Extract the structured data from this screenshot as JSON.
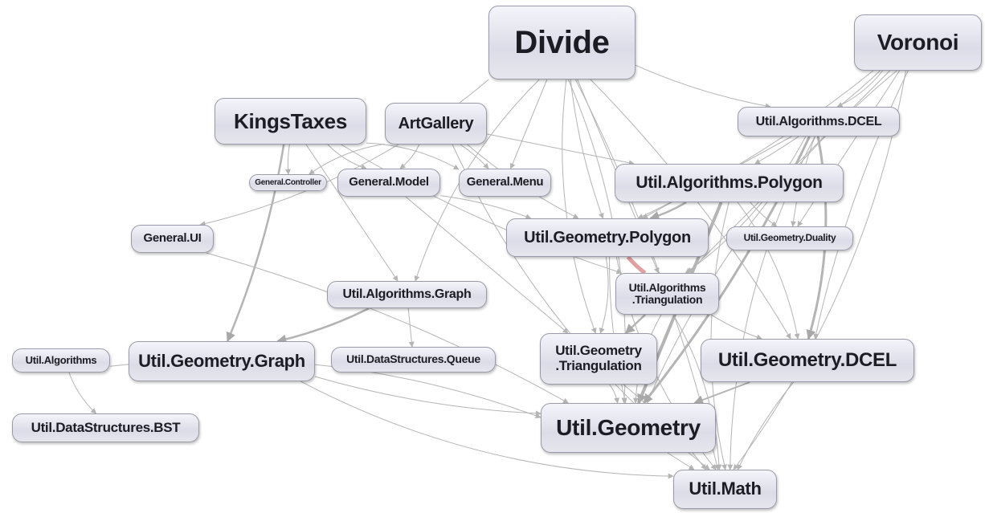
{
  "nodes": [
    {
      "id": "divide",
      "label": "Divide"
    },
    {
      "id": "voronoi",
      "label": "Voronoi"
    },
    {
      "id": "kingstaxes",
      "label": "KingsTaxes"
    },
    {
      "id": "artgallery",
      "label": "ArtGallery"
    },
    {
      "id": "alg_dcel",
      "label": "Util.Algorithms.DCEL"
    },
    {
      "id": "gen_controller",
      "label": "General.Controller"
    },
    {
      "id": "gen_model",
      "label": "General.Model"
    },
    {
      "id": "gen_menu",
      "label": "General.Menu"
    },
    {
      "id": "alg_polygon",
      "label": "Util.Algorithms.Polygon"
    },
    {
      "id": "gen_ui",
      "label": "General.UI"
    },
    {
      "id": "geo_polygon",
      "label": "Util.Geometry.Polygon"
    },
    {
      "id": "geo_duality",
      "label": "Util.Geometry.Duality"
    },
    {
      "id": "alg_triang",
      "label": "Util.Algorithms\n.Triangulation"
    },
    {
      "id": "alg_graph",
      "label": "Util.Algorithms.Graph"
    },
    {
      "id": "geo_graph",
      "label": "Util.Geometry.Graph"
    },
    {
      "id": "ds_queue",
      "label": "Util.DataStructures.Queue"
    },
    {
      "id": "geo_triang",
      "label": "Util.Geometry\n.Triangulation"
    },
    {
      "id": "geo_dcel",
      "label": "Util.Geometry.DCEL"
    },
    {
      "id": "alg",
      "label": "Util.Algorithms"
    },
    {
      "id": "ds_bst",
      "label": "Util.DataStructures.BST"
    },
    {
      "id": "geometry",
      "label": "Util.Geometry"
    },
    {
      "id": "math",
      "label": "Util.Math"
    }
  ],
  "edges": [
    [
      "divide",
      "gen_ui"
    ],
    [
      "divide",
      "math"
    ],
    [
      "divide",
      "gen_menu"
    ],
    [
      "divide",
      "geo_polygon"
    ],
    [
      "divide",
      "geo_triang"
    ],
    [
      "divide",
      "geometry"
    ],
    [
      "divide",
      "geo_dcel"
    ],
    [
      "divide",
      "alg_triang"
    ],
    [
      "divide",
      "alg_dcel"
    ],
    [
      "divide",
      "alg_graph"
    ],
    [
      "voronoi",
      "alg_dcel"
    ],
    [
      "voronoi",
      "alg_polygon"
    ],
    [
      "voronoi",
      "geo_duality"
    ],
    [
      "voronoi",
      "geo_dcel"
    ],
    [
      "voronoi",
      "geometry"
    ],
    [
      "voronoi",
      "math"
    ],
    [
      "voronoi",
      "geo_polygon"
    ],
    [
      "voronoi",
      "alg_triang"
    ],
    [
      "kingstaxes",
      "gen_controller"
    ],
    [
      "kingstaxes",
      "gen_model"
    ],
    [
      "kingstaxes",
      "gen_menu"
    ],
    [
      "kingstaxes",
      "geo_graph",
      2.5
    ],
    [
      "kingstaxes",
      "alg_graph"
    ],
    [
      "kingstaxes",
      "alg_triang"
    ],
    [
      "artgallery",
      "gen_controller"
    ],
    [
      "artgallery",
      "gen_model"
    ],
    [
      "artgallery",
      "gen_menu"
    ],
    [
      "artgallery",
      "alg_polygon"
    ],
    [
      "artgallery",
      "geo_polygon"
    ],
    [
      "artgallery",
      "math"
    ],
    [
      "alg_dcel",
      "geo_dcel",
      3
    ],
    [
      "alg_dcel",
      "geometry",
      3
    ],
    [
      "alg_dcel",
      "geo_polygon"
    ],
    [
      "alg_dcel",
      "geo_duality"
    ],
    [
      "alg_dcel",
      "math"
    ],
    [
      "alg_dcel",
      "alg_triang"
    ],
    [
      "alg_polygon",
      "geo_polygon",
      2.5
    ],
    [
      "alg_polygon",
      "geometry",
      4
    ],
    [
      "alg_polygon",
      "geo_duality"
    ],
    [
      "alg_polygon",
      "math"
    ],
    [
      "alg_polygon",
      "geo_dcel"
    ],
    [
      "gen_model",
      "geo_polygon"
    ],
    [
      "gen_model",
      "geo_triang"
    ],
    [
      "geo_polygon",
      "geometry"
    ],
    [
      "geo_polygon",
      "math"
    ],
    [
      "geo_polygon",
      "geo_triang"
    ],
    [
      "alg_triang",
      "geo_polygon",
      5,
      "#e0a0a0"
    ],
    [
      "alg_triang",
      "geo_triang",
      2.5
    ],
    [
      "alg_triang",
      "geo_dcel"
    ],
    [
      "alg_triang",
      "geometry"
    ],
    [
      "alg_triang",
      "math"
    ],
    [
      "alg_graph",
      "geo_graph",
      2.5
    ],
    [
      "alg_graph",
      "ds_queue"
    ],
    [
      "geo_graph",
      "geometry"
    ],
    [
      "geo_graph",
      "math"
    ],
    [
      "geo_triang",
      "geometry"
    ],
    [
      "geo_triang",
      "math"
    ],
    [
      "geo_dcel",
      "geometry",
      2
    ],
    [
      "geo_dcel",
      "math"
    ],
    [
      "alg",
      "ds_bst"
    ],
    [
      "alg",
      "geometry"
    ],
    [
      "gen_ui",
      "geometry"
    ],
    [
      "geometry",
      "math"
    ]
  ],
  "colors": {
    "edge": "#b4b4b4",
    "highlight_edge": "#e0a0a0",
    "node_border": "#9a9aa8"
  }
}
